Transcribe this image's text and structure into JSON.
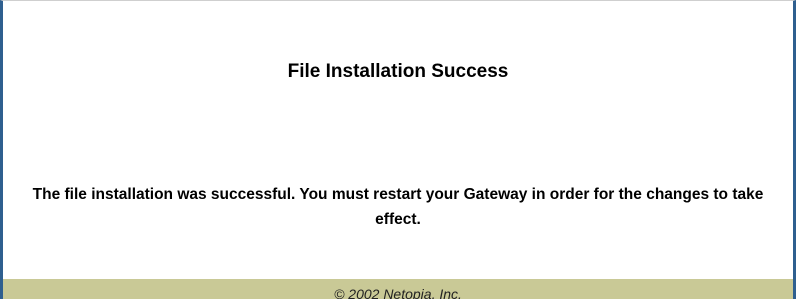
{
  "page": {
    "title": "File Installation Success",
    "message": "The file installation was successful. You must restart your Gateway in order for the changes to take effect.",
    "footer": "© 2002 Netopia, Inc."
  },
  "colors": {
    "frame_border": "#2f5f8f",
    "footer_background": "#c9c996",
    "text": "#000000"
  }
}
